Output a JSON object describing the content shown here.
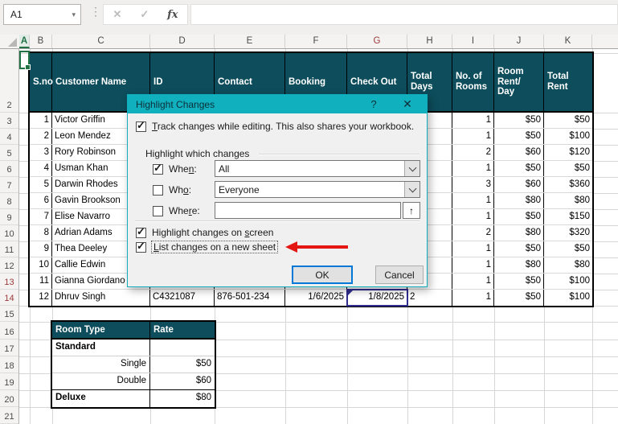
{
  "app": {
    "name_box_value": "A1",
    "formula_bar_value": "",
    "cancel_icon": "✕",
    "enter_icon": "✓",
    "function_icon": "fx",
    "separator_icon": "⋮",
    "name_box_dropdown_icon": "▾"
  },
  "grid": {
    "column_letters": [
      "A",
      "B",
      "C",
      "D",
      "E",
      "F",
      "G",
      "H",
      "I",
      "J",
      "K"
    ],
    "selected_column": "A",
    "red_columns": [
      "G"
    ],
    "row_numbers": [
      "2",
      "3",
      "4",
      "5",
      "6",
      "7",
      "8",
      "9",
      "10",
      "11",
      "12",
      "13",
      "14",
      "15",
      "16",
      "17",
      "18",
      "19",
      "20",
      "21"
    ],
    "red_rows": [
      "13",
      "14"
    ]
  },
  "main_table": {
    "headers": [
      "S.no",
      "Customer Name",
      "ID",
      "Contact",
      "Booking",
      "Check Out",
      "Total Days",
      "No. of Rooms",
      "Room Rent/ Day",
      "Total Rent"
    ],
    "rows": [
      [
        "1",
        "Victor Griffin",
        "",
        "",
        "",
        "",
        "",
        "1",
        "$50",
        "$50"
      ],
      [
        "2",
        "Leon Mendez",
        "",
        "",
        "",
        "",
        "",
        "1",
        "$50",
        "$100"
      ],
      [
        "3",
        "Rory Robinson",
        "",
        "",
        "",
        "",
        "",
        "2",
        "$60",
        "$120"
      ],
      [
        "4",
        "Usman Khan",
        "",
        "",
        "",
        "",
        "",
        "1",
        "$50",
        "$50"
      ],
      [
        "5",
        "Darwin Rhodes",
        "",
        "",
        "",
        "",
        "",
        "3",
        "$60",
        "$360"
      ],
      [
        "6",
        "Gavin Brookson",
        "",
        "",
        "",
        "",
        "",
        "1",
        "$80",
        "$80"
      ],
      [
        "7",
        "Elise Navarro",
        "",
        "",
        "",
        "",
        "",
        "1",
        "$50",
        "$150"
      ],
      [
        "8",
        "Adrian Adams",
        "",
        "",
        "",
        "",
        "",
        "2",
        "$80",
        "$320"
      ],
      [
        "9",
        "Thea Deeley",
        "",
        "",
        "",
        "",
        "",
        "1",
        "$50",
        "$50"
      ],
      [
        "10",
        "Callie Edwin",
        "",
        "",
        "",
        "",
        "",
        "1",
        "$80",
        "$80"
      ],
      [
        "11",
        "Gianna Giordano",
        "",
        "",
        "",
        "",
        "",
        "1",
        "$50",
        "$100"
      ],
      [
        "12",
        "Dhruv Singh",
        "C4321087",
        "876-501-234",
        "1/6/2025",
        "1/8/2025",
        "2",
        "1",
        "$50",
        "$100"
      ]
    ]
  },
  "room_table": {
    "headers": [
      "Room Type",
      "Rate"
    ],
    "rows": [
      [
        "Standard",
        ""
      ],
      [
        "Single",
        "$50"
      ],
      [
        "Double",
        "$60"
      ],
      [
        "Deluxe",
        "$80"
      ]
    ]
  },
  "dialog": {
    "title": "Highlight Changes",
    "help_icon": "?",
    "close_icon": "✕",
    "track_label": "Track changes while editing. This also shares your workbook.",
    "group_label": "Highlight which changes",
    "when_label": "When:",
    "when_value": "All",
    "who_label": "Who:",
    "who_value": "Everyone",
    "where_label": "Where:",
    "where_value": "",
    "collapse_icon": "↑",
    "highlight_screen_label": "Highlight changes on screen",
    "list_sheet_label": "List changes on a new sheet",
    "ok_label": "OK",
    "cancel_label": "Cancel"
  },
  "colors": {
    "table_header_fill": "#0d4d5c",
    "dialog_titlebar": "#10b0be",
    "selection_green": "#217346",
    "tracked_change_border": "#2f2d8e",
    "arrow_red": "#e41613",
    "red_header_text": "#9c3a3a"
  }
}
